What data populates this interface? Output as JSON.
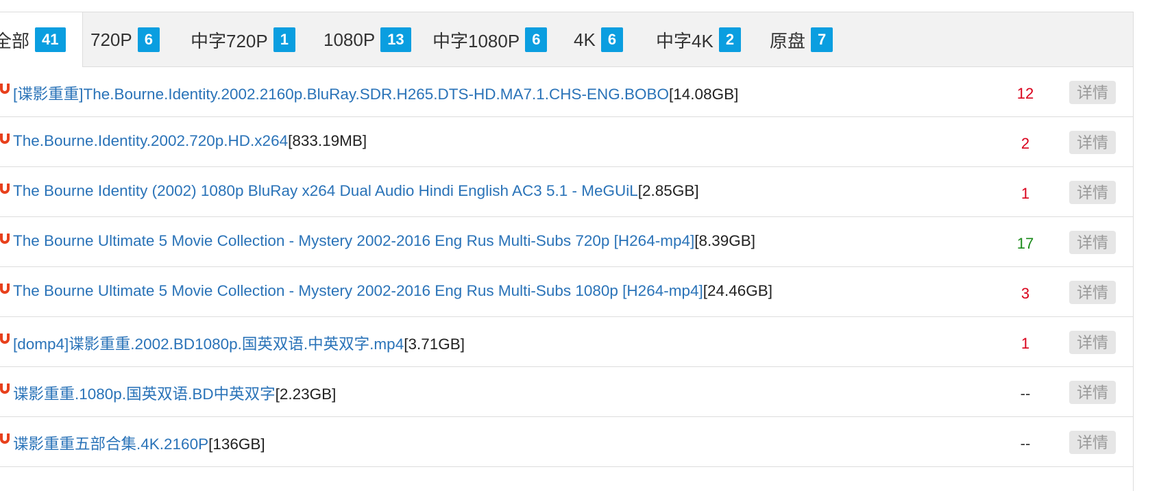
{
  "tabs": [
    {
      "label": "全部",
      "count": "41",
      "active": true
    },
    {
      "label": "720P",
      "count": "6"
    },
    {
      "label": "中字720P",
      "count": "1"
    },
    {
      "label": "1080P",
      "count": "13"
    },
    {
      "label": "中字1080P",
      "count": "6"
    },
    {
      "label": "4K",
      "count": "6"
    },
    {
      "label": "中字4K",
      "count": "2"
    },
    {
      "label": "原盘",
      "count": "7"
    }
  ],
  "rows": [
    {
      "title": "[谍影重重]The.Bourne.Identity.2002.2160p.BluRay.SDR.H265.DTS-HD.MA7.1.CHS-ENG.BOBO",
      "size": "[14.08GB]",
      "count": "12",
      "count_color": "#d9001b",
      "action": "详情"
    },
    {
      "title": "The.Bourne.Identity.2002.720p.HD.x264",
      "size": "[833.19MB]",
      "count": "2",
      "count_color": "#d9001b",
      "action": "详情"
    },
    {
      "title": "The Bourne Identity (2002) 1080p BluRay x264 Dual Audio Hindi English AC3 5.1 - MeGUiL",
      "size": "[2.85GB]",
      "count": "1",
      "count_color": "#d9001b",
      "action": "详情"
    },
    {
      "title": "The Bourne Ultimate 5 Movie Collection - Mystery 2002-2016 Eng Rus Multi-Subs 720p [H264-mp4]",
      "size": "[8.39GB]",
      "count": "17",
      "count_color": "#1a8a1a",
      "action": "详情"
    },
    {
      "title": "The Bourne Ultimate 5 Movie Collection - Mystery 2002-2016 Eng Rus Multi-Subs 1080p [H264-mp4]",
      "size": "[24.46GB]",
      "count": "3",
      "count_color": "#d9001b",
      "action": "详情"
    },
    {
      "title": "[domp4]谍影重重.2002.BD1080p.国英双语.中英双字.mp4",
      "size": "[3.71GB]",
      "count": "1",
      "count_color": "#d9001b",
      "action": "详情"
    },
    {
      "title": "谍影重重.1080p.国英双语.BD中英双字",
      "size": "[2.23GB]",
      "count": "--",
      "count_color": "#333333",
      "action": "详情"
    },
    {
      "title": "谍影重重五部合集.4K.2160P",
      "size": "[136GB]",
      "count": "--",
      "count_color": "#333333",
      "action": "详情"
    }
  ],
  "colors": {
    "badge": "#0a9ee0",
    "link": "#2a73b8",
    "magnet": "#e8401c"
  },
  "icons": {
    "row_icon": "magnet-icon"
  }
}
